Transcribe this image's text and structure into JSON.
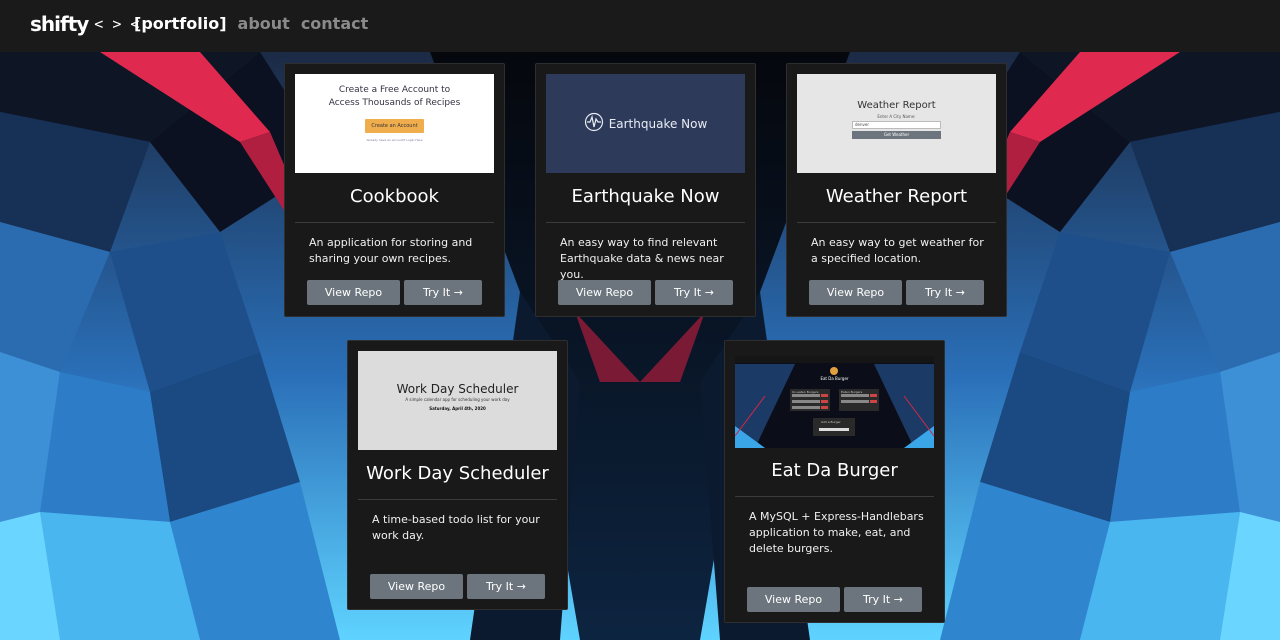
{
  "nav": {
    "brand": "shifty",
    "brand_glyphs": "< > <",
    "links": [
      {
        "label": "[portfolio]",
        "active": true
      },
      {
        "label": "about",
        "active": false
      },
      {
        "label": "contact",
        "active": false
      }
    ]
  },
  "colors": {
    "navbar": "#1a1a1a",
    "card": "#191919",
    "button": "#6c757d",
    "nav_inactive": "#8a8a8a"
  },
  "projects": [
    {
      "title": "Cookbook",
      "description": "An application for storing and sharing your own recipes.",
      "repo_label": "View Repo",
      "try_label": "Try It →",
      "thumb": {
        "heading": "Create a Free Account to Access Thousands of Recipes",
        "button": "Create an Account",
        "small": "Already have an account? Login Here"
      }
    },
    {
      "title": "Earthquake Now",
      "description": "An easy way to find relevant Earthquake data & news near you.",
      "repo_label": "View Repo",
      "try_label": "Try It →",
      "thumb": {
        "icon": "seismograph-icon",
        "label": "Earthquake Now"
      }
    },
    {
      "title": "Weather Report",
      "description": "An easy way to get weather for a specified location.",
      "repo_label": "View Repo",
      "try_label": "Try It →",
      "thumb": {
        "heading": "Weather Report",
        "label": "Enter A City Name:",
        "input_value": "denver",
        "button": "Get Weather"
      }
    },
    {
      "title": "Work Day Scheduler",
      "description": "A time-based todo list for your work day.",
      "repo_label": "View Repo",
      "try_label": "Try It →",
      "thumb": {
        "heading": "Work Day Scheduler",
        "subheading": "A simple calendar app for scheduling your work day",
        "date": "Saturday, April 4th, 2020"
      }
    },
    {
      "title": "Eat Da Burger",
      "description": "A MySQL + Express-Handlebars application to make, eat, and delete burgers.",
      "repo_label": "View Repo",
      "try_label": "Try It →",
      "thumb": {
        "heading": "Eat Da Burger",
        "left_col": "Un-eaten Burgers",
        "right_col": "Eaten Burgers",
        "form_label": "Add a Burger"
      }
    }
  ]
}
